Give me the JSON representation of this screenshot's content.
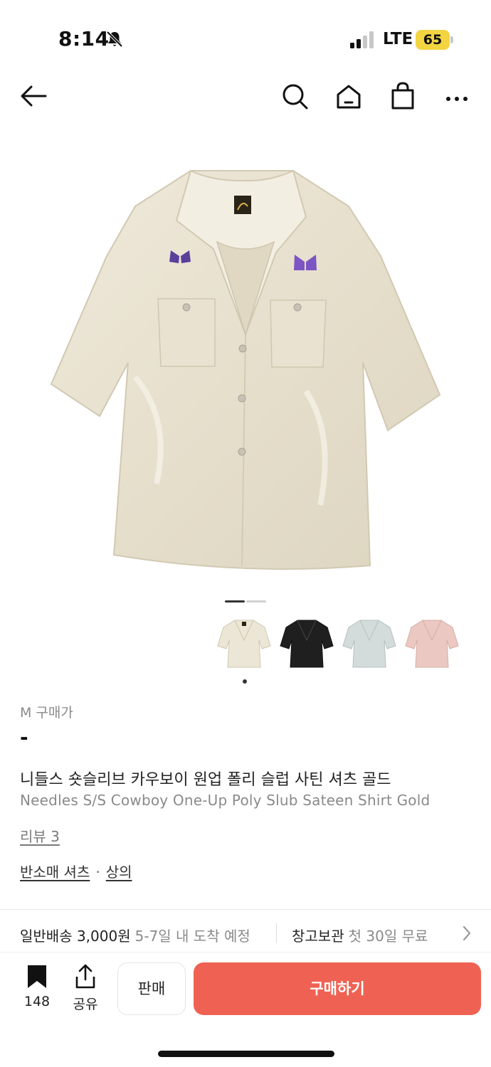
{
  "status_bar": {
    "time": "8:14",
    "network": "LTE",
    "battery": "65",
    "icons": [
      "bell-slash-icon",
      "signal-icon"
    ]
  },
  "nav": {
    "icons": [
      "back-arrow-icon",
      "search-icon",
      "home-icon",
      "shopping-bag-icon",
      "more-icon"
    ]
  },
  "gallery": {
    "thumbnails": [
      {
        "name": "gold",
        "color": "#ece6d6"
      },
      {
        "name": "black",
        "color": "#1f1f1f"
      },
      {
        "name": "light-blue",
        "color": "#d3dcdb"
      },
      {
        "name": "pink",
        "color": "#ecc8c2"
      }
    ],
    "active_page": 1,
    "page_count": 2
  },
  "product": {
    "size_label": "M 구매가",
    "price": "-",
    "title_ko": "니들스 숏슬리브 카우보이 원업 폴리 슬럽 사틴 셔츠 골드",
    "title_en": "Needles S/S Cowboy One-Up Poly Slub Sateen Shirt Gold",
    "review": "리뷰 3",
    "category_1": "반소매 셔츠",
    "category_separator": "·",
    "category_2": "상의"
  },
  "shipping": {
    "general_label": "일반배송 3,000원",
    "general_detail": "5-7일 내 도착 예정",
    "storage_label": "창고보관",
    "storage_detail": "첫 30일 무료"
  },
  "bottom_bar": {
    "bookmark_count": "148",
    "share_label": "공유",
    "sell_label": "판매",
    "buy_label": "구매하기"
  },
  "colors": {
    "accent": "#ef6253",
    "battery": "#f3d542"
  }
}
